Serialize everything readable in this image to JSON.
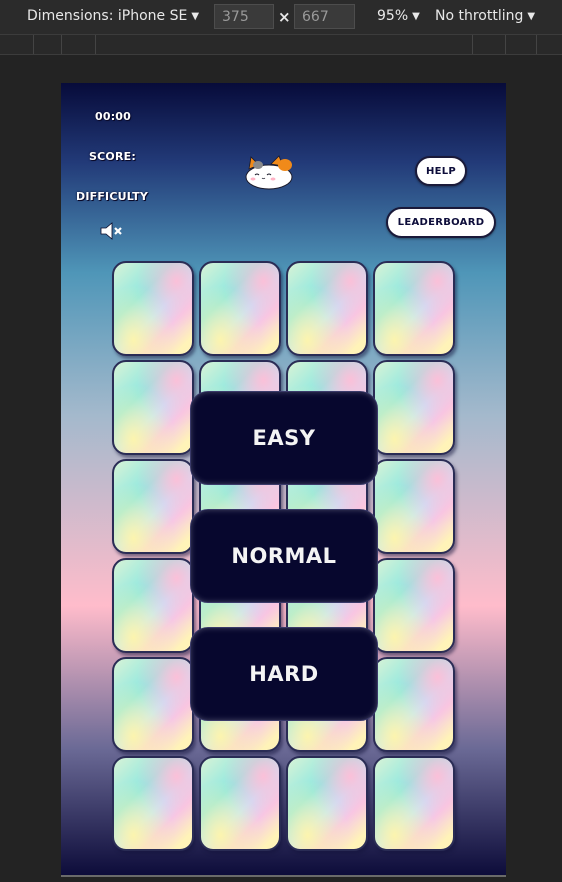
{
  "devtools": {
    "dimensions_label": "Dimensions: iPhone SE",
    "width_value": "375",
    "height_value": "667",
    "times": "×",
    "zoom": "95%",
    "throttling": "No throttling"
  },
  "game": {
    "timer": "00:00",
    "score_label": "SCORE:",
    "difficulty_label": "DIFFICULTY",
    "help_button": "HELP",
    "leaderboard_button": "LEADERBOARD",
    "sound_muted": true,
    "card_rows": 6,
    "card_cols": 4,
    "difficulty_options": [
      "EASY",
      "NORMAL",
      "HARD"
    ],
    "colors": {
      "button_bg": "#07072e",
      "text_dark": "#0d0d3a"
    }
  }
}
